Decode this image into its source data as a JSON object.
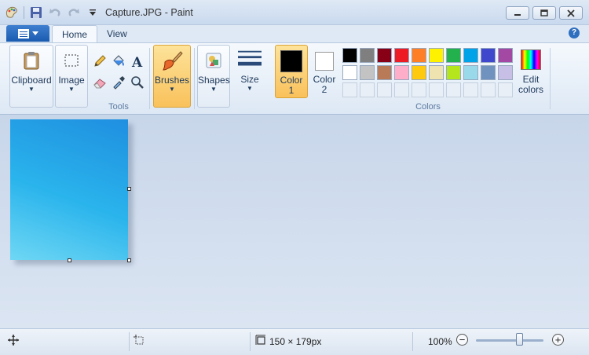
{
  "window": {
    "title": "Capture.JPG - Paint",
    "controls": [
      "minimize",
      "maximize",
      "close"
    ]
  },
  "quick_access": [
    "paint-logo",
    "save",
    "undo",
    "redo",
    "customize-dropdown"
  ],
  "tabs": [
    {
      "label": "Home",
      "active": true
    },
    {
      "label": "View",
      "active": false
    }
  ],
  "ribbon": {
    "clipboard": {
      "label": "Clipboard"
    },
    "image": {
      "label": "Image"
    },
    "tools": {
      "label": "Tools",
      "items": [
        "pencil",
        "fill",
        "text",
        "eraser",
        "color-picker",
        "magnifier"
      ]
    },
    "brushes": {
      "label": "Brushes"
    },
    "shapes": {
      "label": "Shapes"
    },
    "size": {
      "label": "Size"
    },
    "color1": {
      "label": "Color 1",
      "value": "#000000"
    },
    "color2": {
      "label": "Color 2",
      "value": "#ffffff"
    },
    "colors": {
      "label": "Colors",
      "row1": [
        "#000000",
        "#7f7f7f",
        "#880015",
        "#ed1c24",
        "#ff7f27",
        "#fff200",
        "#22b14c",
        "#00a2e8",
        "#3f48cc",
        "#a349a4"
      ],
      "row2": [
        "#ffffff",
        "#c3c3c3",
        "#b97a57",
        "#ffaec9",
        "#ffc90e",
        "#efe4b0",
        "#b5e61d",
        "#99d9ea",
        "#7092be",
        "#c8bfe7"
      ]
    },
    "edit_colors": {
      "label": "Edit colors"
    }
  },
  "canvas": {
    "gradient_colors": [
      "#1f8fe0",
      "#2ab4ec",
      "#6fd7f4"
    ]
  },
  "statusbar": {
    "image_size": "150 × 179px",
    "zoom": "100%",
    "zoom_level": 1.0
  }
}
